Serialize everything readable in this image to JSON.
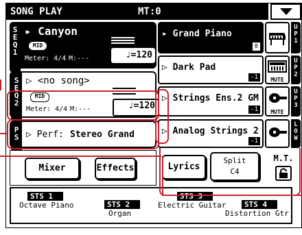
{
  "title_bar": {
    "title": "SONG PLAY",
    "mt": "MT:0"
  },
  "seq1": {
    "sidebar": [
      "S",
      "E",
      "Q",
      "1"
    ],
    "song": "▸ Canyon",
    "mid_badge": "MID",
    "meter": "Meter: 4/4",
    "measure": "M:---",
    "tempo": "♩=120"
  },
  "seq2": {
    "sidebar": [
      "S",
      "E",
      "Q",
      "2"
    ],
    "song": "▷ <no song>",
    "mid_badge": "MID",
    "meter": "Meter: 4/4",
    "measure": "M:---",
    "tempo": "♩=120"
  },
  "perf": {
    "sidebar": [
      "P",
      "S"
    ],
    "label": "▷ Perf:",
    "value": "Stereo Grand"
  },
  "tracks": [
    {
      "name": "▸ Grand Piano",
      "octave": "0",
      "upper": [
        "U",
        "P",
        "1"
      ],
      "icon": "grand-piano-icon",
      "mute": ""
    },
    {
      "name": "▷ Dark Pad",
      "octave": "-1",
      "upper": [
        "U",
        "P",
        "2"
      ],
      "icon": "synth-keyboard-icon",
      "mute": "MUTE"
    },
    {
      "name": "▷ Strings Ens.2 GM",
      "octave": "-1",
      "upper": [
        "U",
        "P",
        "3"
      ],
      "icon": "violin-icon",
      "mute": "MUTE"
    },
    {
      "name": "▷ Analog Strings 2",
      "octave": "-1",
      "upper": [
        "L",
        "O",
        "W"
      ],
      "icon": "violin-icon",
      "mute": ""
    }
  ],
  "buttons": {
    "mixer": "Mixer",
    "effects": "Effects",
    "lyrics": "Lyrics",
    "split_line1": "Split",
    "split_line2": "C4",
    "mt_label": "M.T."
  },
  "sts": [
    {
      "title": "STS 1",
      "name": "Octave Piano"
    },
    {
      "title": "STS 2",
      "name": "Organ"
    },
    {
      "title": "STS 3",
      "name": "Electric Guitar"
    },
    {
      "title": "STS 4",
      "name": "Distortion Gtr"
    }
  ],
  "colors": {
    "highlight": "#cc1f2a"
  }
}
